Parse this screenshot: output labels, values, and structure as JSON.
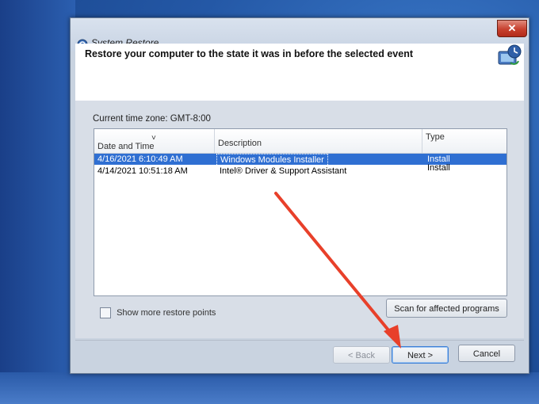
{
  "window": {
    "title": "System Restore",
    "close_label": "✕"
  },
  "header": {
    "title": "Restore your computer to the state it was in before the selected event"
  },
  "timezone": {
    "label": "Current time zone: GMT-8:00"
  },
  "list": {
    "columns": [
      "Date and Time",
      "Description",
      "Type"
    ],
    "sort_indicator": "˅",
    "rows": [
      {
        "date": "4/16/2021 6:10:49 AM",
        "description": "Windows Modules Installer",
        "type": "Install",
        "selected": true
      },
      {
        "date": "4/14/2021 10:51:18 AM",
        "description": "Intel® Driver & Support Assistant",
        "type": "Install",
        "selected": false
      }
    ]
  },
  "options": {
    "show_more_label": "Show more restore points",
    "scan_button": "Scan for affected programs"
  },
  "footer": {
    "back_button": "< Back",
    "next_button": "Next >",
    "cancel_button": "Cancel"
  },
  "colors": {
    "selection": "#2f6fd2",
    "close_red": "#c7402e",
    "arrow": "#e8402a"
  }
}
